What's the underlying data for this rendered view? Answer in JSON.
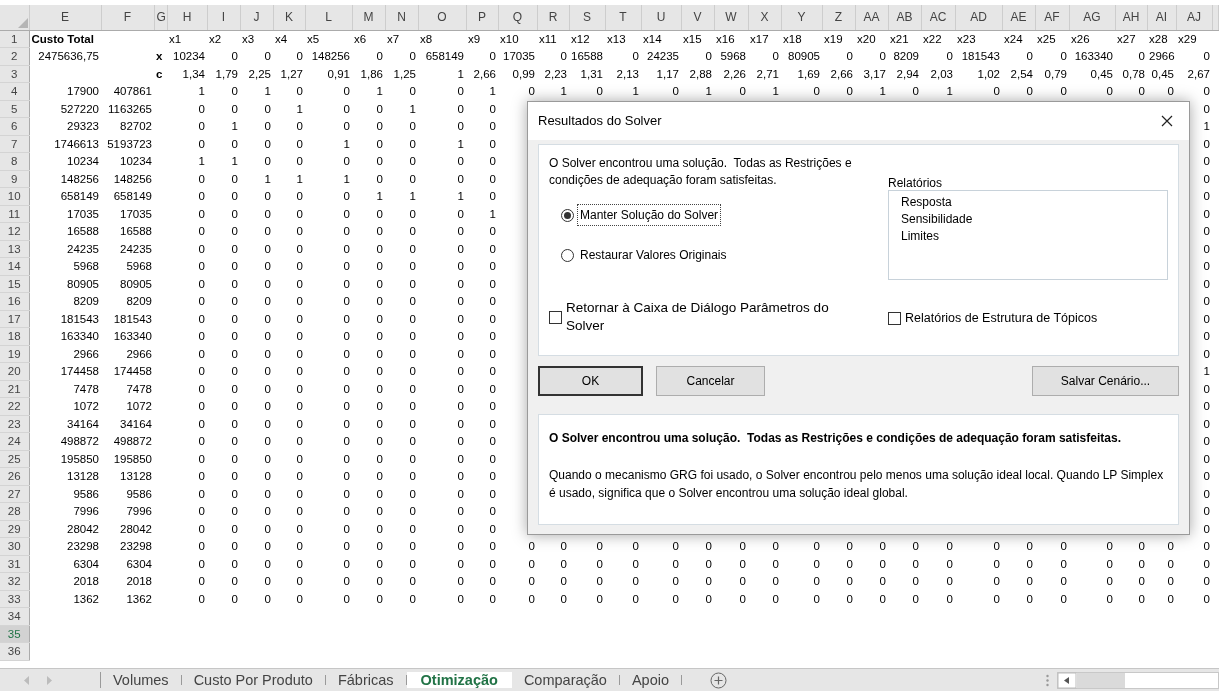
{
  "sheet": {
    "column_headers": [
      "E",
      "F",
      "G",
      "H",
      "I",
      "J",
      "K",
      "L",
      "M",
      "N",
      "O",
      "P",
      "Q",
      "R",
      "S",
      "T",
      "U",
      "V",
      "W",
      "X",
      "Y",
      "Z",
      "AA",
      "AB",
      "AC",
      "AD",
      "AE",
      "AF",
      "AG",
      "AH",
      "AI",
      "AJ"
    ],
    "rows": [
      {
        "number": "1",
        "selected": false,
        "cells": [
          "Custo Total",
          null,
          null,
          "x1",
          "x2",
          "x3",
          "x4",
          "x5",
          "x6",
          "x7",
          "x8",
          "x9",
          "x10",
          "x11",
          "x12",
          "x13",
          "x14",
          "x15",
          "x16",
          "x17",
          "x18",
          "x19",
          "x20",
          "x21",
          "x22",
          "x23",
          "x24",
          "x25",
          "x26",
          "x27",
          "x28",
          "x29"
        ]
      },
      {
        "number": "2",
        "selected": false,
        "cells": [
          "2475636,75",
          null,
          "x",
          "10234",
          "0",
          "0",
          "0",
          "148256",
          "0",
          "0",
          "658149",
          "0",
          "17035",
          "0",
          "16588",
          "0",
          "24235",
          "0",
          "5968",
          "0",
          "80905",
          "0",
          "0",
          "8209",
          "0",
          "181543",
          "0",
          "0",
          "163340",
          "0",
          "2966",
          "0"
        ]
      },
      {
        "number": "3",
        "selected": false,
        "cells": [
          null,
          null,
          "c",
          "1,34",
          "1,79",
          "2,25",
          "1,27",
          "0,91",
          "1,86",
          "1,25",
          "1",
          "2,66",
          "0,99",
          "2,23",
          "1,31",
          "2,13",
          "1,17",
          "2,88",
          "2,26",
          "2,71",
          "1,69",
          "2,66",
          "3,17",
          "2,94",
          "2,03",
          "1,02",
          "2,54",
          "0,79",
          "0,45",
          "0,78",
          "0,45",
          "2,67"
        ]
      },
      {
        "number": "4",
        "selected": false,
        "cells": [
          "17900",
          "407861",
          null,
          "1",
          "0",
          "1",
          "0",
          "0",
          "1",
          "0",
          "0",
          "1",
          "0",
          "1",
          "0",
          "1",
          "0",
          "1",
          "0",
          "1",
          "0",
          "0",
          "1",
          "0",
          "1",
          "0",
          "0",
          "0",
          "0",
          "0",
          "0",
          "0"
        ]
      },
      {
        "number": "5",
        "selected": false,
        "cells": [
          "527220",
          "1163265",
          null,
          "0",
          "0",
          "0",
          "1",
          "0",
          "0",
          "1",
          "0",
          "0",
          null,
          null,
          null,
          null,
          null,
          null,
          null,
          null,
          null,
          null,
          null,
          null,
          null,
          null,
          null,
          null,
          null,
          null,
          null,
          "0"
        ]
      },
      {
        "number": "6",
        "selected": false,
        "cells": [
          "29323",
          "82702",
          null,
          "0",
          "1",
          "0",
          "0",
          "0",
          "0",
          "0",
          "0",
          "0",
          null,
          null,
          null,
          null,
          null,
          null,
          null,
          null,
          null,
          null,
          null,
          null,
          null,
          null,
          null,
          null,
          null,
          null,
          null,
          "1"
        ]
      },
      {
        "number": "7",
        "selected": false,
        "cells": [
          "1746613",
          "5193723",
          null,
          "0",
          "0",
          "0",
          "0",
          "1",
          "0",
          "0",
          "1",
          "0",
          null,
          null,
          null,
          null,
          null,
          null,
          null,
          null,
          null,
          null,
          null,
          null,
          null,
          null,
          null,
          null,
          null,
          null,
          null,
          "0"
        ]
      },
      {
        "number": "8",
        "selected": false,
        "cells": [
          "10234",
          "10234",
          null,
          "1",
          "1",
          "0",
          "0",
          "0",
          "0",
          "0",
          "0",
          "0",
          null,
          null,
          null,
          null,
          null,
          null,
          null,
          null,
          null,
          null,
          null,
          null,
          null,
          null,
          null,
          null,
          null,
          null,
          null,
          "0"
        ]
      },
      {
        "number": "9",
        "selected": false,
        "cells": [
          "148256",
          "148256",
          null,
          "0",
          "0",
          "1",
          "1",
          "1",
          "0",
          "0",
          "0",
          "0",
          null,
          null,
          null,
          null,
          null,
          null,
          null,
          null,
          null,
          null,
          null,
          null,
          null,
          null,
          null,
          null,
          null,
          null,
          null,
          "0"
        ]
      },
      {
        "number": "10",
        "selected": false,
        "cells": [
          "658149",
          "658149",
          null,
          "0",
          "0",
          "0",
          "0",
          "0",
          "1",
          "1",
          "1",
          "0",
          null,
          null,
          null,
          null,
          null,
          null,
          null,
          null,
          null,
          null,
          null,
          null,
          null,
          null,
          null,
          null,
          null,
          null,
          null,
          "0"
        ]
      },
      {
        "number": "11",
        "selected": false,
        "cells": [
          "17035",
          "17035",
          null,
          "0",
          "0",
          "0",
          "0",
          "0",
          "0",
          "0",
          "0",
          "1",
          null,
          null,
          null,
          null,
          null,
          null,
          null,
          null,
          null,
          null,
          null,
          null,
          null,
          null,
          null,
          null,
          null,
          null,
          null,
          "0"
        ]
      },
      {
        "number": "12",
        "selected": false,
        "cells": [
          "16588",
          "16588",
          null,
          "0",
          "0",
          "0",
          "0",
          "0",
          "0",
          "0",
          "0",
          "0",
          null,
          null,
          null,
          null,
          null,
          null,
          null,
          null,
          null,
          null,
          null,
          null,
          null,
          null,
          null,
          null,
          null,
          null,
          null,
          "0"
        ]
      },
      {
        "number": "13",
        "selected": false,
        "cells": [
          "24235",
          "24235",
          null,
          "0",
          "0",
          "0",
          "0",
          "0",
          "0",
          "0",
          "0",
          "0",
          null,
          null,
          null,
          null,
          null,
          null,
          null,
          null,
          null,
          null,
          null,
          null,
          null,
          null,
          null,
          null,
          null,
          null,
          null,
          "0"
        ]
      },
      {
        "number": "14",
        "selected": false,
        "cells": [
          "5968",
          "5968",
          null,
          "0",
          "0",
          "0",
          "0",
          "0",
          "0",
          "0",
          "0",
          "0",
          null,
          null,
          null,
          null,
          null,
          null,
          null,
          null,
          null,
          null,
          null,
          null,
          null,
          null,
          null,
          null,
          null,
          null,
          null,
          "0"
        ]
      },
      {
        "number": "15",
        "selected": false,
        "cells": [
          "80905",
          "80905",
          null,
          "0",
          "0",
          "0",
          "0",
          "0",
          "0",
          "0",
          "0",
          "0",
          null,
          null,
          null,
          null,
          null,
          null,
          null,
          null,
          null,
          null,
          null,
          null,
          null,
          null,
          null,
          null,
          null,
          null,
          null,
          "0"
        ]
      },
      {
        "number": "16",
        "selected": false,
        "cells": [
          "8209",
          "8209",
          null,
          "0",
          "0",
          "0",
          "0",
          "0",
          "0",
          "0",
          "0",
          "0",
          null,
          null,
          null,
          null,
          null,
          null,
          null,
          null,
          null,
          null,
          null,
          null,
          null,
          null,
          null,
          null,
          null,
          null,
          null,
          "0"
        ]
      },
      {
        "number": "17",
        "selected": false,
        "cells": [
          "181543",
          "181543",
          null,
          "0",
          "0",
          "0",
          "0",
          "0",
          "0",
          "0",
          "0",
          "0",
          null,
          null,
          null,
          null,
          null,
          null,
          null,
          null,
          null,
          null,
          null,
          null,
          null,
          null,
          null,
          null,
          null,
          null,
          null,
          "0"
        ]
      },
      {
        "number": "18",
        "selected": false,
        "cells": [
          "163340",
          "163340",
          null,
          "0",
          "0",
          "0",
          "0",
          "0",
          "0",
          "0",
          "0",
          "0",
          null,
          null,
          null,
          null,
          null,
          null,
          null,
          null,
          null,
          null,
          null,
          null,
          null,
          null,
          null,
          null,
          null,
          null,
          null,
          "0"
        ]
      },
      {
        "number": "19",
        "selected": false,
        "cells": [
          "2966",
          "2966",
          null,
          "0",
          "0",
          "0",
          "0",
          "0",
          "0",
          "0",
          "0",
          "0",
          null,
          null,
          null,
          null,
          null,
          null,
          null,
          null,
          null,
          null,
          null,
          null,
          null,
          null,
          null,
          null,
          null,
          null,
          null,
          "0"
        ]
      },
      {
        "number": "20",
        "selected": false,
        "cells": [
          "174458",
          "174458",
          null,
          "0",
          "0",
          "0",
          "0",
          "0",
          "0",
          "0",
          "0",
          "0",
          null,
          null,
          null,
          null,
          null,
          null,
          null,
          null,
          null,
          null,
          null,
          null,
          null,
          null,
          null,
          null,
          null,
          null,
          null,
          "1"
        ]
      },
      {
        "number": "21",
        "selected": false,
        "cells": [
          "7478",
          "7478",
          null,
          "0",
          "0",
          "0",
          "0",
          "0",
          "0",
          "0",
          "0",
          "0",
          null,
          null,
          null,
          null,
          null,
          null,
          null,
          null,
          null,
          null,
          null,
          null,
          null,
          null,
          null,
          null,
          null,
          null,
          null,
          "0"
        ]
      },
      {
        "number": "22",
        "selected": false,
        "cells": [
          "1072",
          "1072",
          null,
          "0",
          "0",
          "0",
          "0",
          "0",
          "0",
          "0",
          "0",
          "0",
          null,
          null,
          null,
          null,
          null,
          null,
          null,
          null,
          null,
          null,
          null,
          null,
          null,
          null,
          null,
          null,
          null,
          null,
          null,
          "0"
        ]
      },
      {
        "number": "23",
        "selected": false,
        "cells": [
          "34164",
          "34164",
          null,
          "0",
          "0",
          "0",
          "0",
          "0",
          "0",
          "0",
          "0",
          "0",
          null,
          null,
          null,
          null,
          null,
          null,
          null,
          null,
          null,
          null,
          null,
          null,
          null,
          null,
          null,
          null,
          null,
          null,
          null,
          "0"
        ]
      },
      {
        "number": "24",
        "selected": false,
        "cells": [
          "498872",
          "498872",
          null,
          "0",
          "0",
          "0",
          "0",
          "0",
          "0",
          "0",
          "0",
          "0",
          null,
          null,
          null,
          null,
          null,
          null,
          null,
          null,
          null,
          null,
          null,
          null,
          null,
          null,
          null,
          null,
          null,
          null,
          null,
          "0"
        ]
      },
      {
        "number": "25",
        "selected": false,
        "cells": [
          "195850",
          "195850",
          null,
          "0",
          "0",
          "0",
          "0",
          "0",
          "0",
          "0",
          "0",
          "0",
          null,
          null,
          null,
          null,
          null,
          null,
          null,
          null,
          null,
          null,
          null,
          null,
          null,
          null,
          null,
          null,
          null,
          null,
          null,
          "0"
        ]
      },
      {
        "number": "26",
        "selected": false,
        "cells": [
          "13128",
          "13128",
          null,
          "0",
          "0",
          "0",
          "0",
          "0",
          "0",
          "0",
          "0",
          "0",
          null,
          null,
          null,
          null,
          null,
          null,
          null,
          null,
          null,
          null,
          null,
          null,
          null,
          null,
          null,
          null,
          null,
          null,
          null,
          "0"
        ]
      },
      {
        "number": "27",
        "selected": false,
        "cells": [
          "9586",
          "9586",
          null,
          "0",
          "0",
          "0",
          "0",
          "0",
          "0",
          "0",
          "0",
          "0",
          null,
          null,
          null,
          null,
          null,
          null,
          null,
          null,
          null,
          null,
          null,
          null,
          null,
          null,
          null,
          null,
          null,
          null,
          null,
          "0"
        ]
      },
      {
        "number": "28",
        "selected": false,
        "cells": [
          "7996",
          "7996",
          null,
          "0",
          "0",
          "0",
          "0",
          "0",
          "0",
          "0",
          "0",
          "0",
          null,
          null,
          null,
          null,
          null,
          null,
          null,
          null,
          null,
          null,
          null,
          null,
          null,
          null,
          null,
          null,
          null,
          null,
          null,
          "0"
        ]
      },
      {
        "number": "29",
        "selected": false,
        "cells": [
          "28042",
          "28042",
          null,
          "0",
          "0",
          "0",
          "0",
          "0",
          "0",
          "0",
          "0",
          "0",
          null,
          null,
          null,
          null,
          null,
          null,
          null,
          null,
          null,
          null,
          null,
          null,
          null,
          null,
          null,
          null,
          null,
          null,
          null,
          "0"
        ]
      },
      {
        "number": "30",
        "selected": false,
        "cells": [
          "23298",
          "23298",
          null,
          "0",
          "0",
          "0",
          "0",
          "0",
          "0",
          "0",
          "0",
          "0",
          "0",
          "0",
          "0",
          "0",
          "0",
          "0",
          "0",
          "0",
          "0",
          "0",
          "0",
          "0",
          "0",
          "0",
          "0",
          "0",
          "0",
          "0",
          "0",
          "0"
        ]
      },
      {
        "number": "31",
        "selected": false,
        "cells": [
          "6304",
          "6304",
          null,
          "0",
          "0",
          "0",
          "0",
          "0",
          "0",
          "0",
          "0",
          "0",
          "0",
          "0",
          "0",
          "0",
          "0",
          "0",
          "0",
          "0",
          "0",
          "0",
          "0",
          "0",
          "0",
          "0",
          "0",
          "0",
          "0",
          "0",
          "0",
          "0"
        ]
      },
      {
        "number": "32",
        "selected": false,
        "cells": [
          "2018",
          "2018",
          null,
          "0",
          "0",
          "0",
          "0",
          "0",
          "0",
          "0",
          "0",
          "0",
          "0",
          "0",
          "0",
          "0",
          "0",
          "0",
          "0",
          "0",
          "0",
          "0",
          "0",
          "0",
          "0",
          "0",
          "0",
          "0",
          "0",
          "0",
          "0",
          "0"
        ]
      },
      {
        "number": "33",
        "selected": false,
        "cells": [
          "1362",
          "1362",
          null,
          "0",
          "0",
          "0",
          "0",
          "0",
          "0",
          "0",
          "0",
          "0",
          "0",
          "0",
          "0",
          "0",
          "0",
          "0",
          "0",
          "0",
          "0",
          "0",
          "0",
          "0",
          "0",
          "0",
          "0",
          "0",
          "0",
          "0",
          "0",
          "0"
        ]
      },
      {
        "number": "34",
        "selected": false
      },
      {
        "number": "35",
        "selected": true
      },
      {
        "number": "36",
        "selected": false
      }
    ]
  },
  "dialog": {
    "title": "Resultados do Solver",
    "message": "O Solver encontrou uma solução.  Todas as Restrições e condições de adequação foram satisfeitas.",
    "options": [
      {
        "label": "Manter Solução do Solver",
        "selected": true
      },
      {
        "label": "Restaurar Valores Originais",
        "selected": false
      }
    ],
    "reports_label": "Relatórios",
    "reports": [
      {
        "label": "Resposta",
        "selected": false
      },
      {
        "label": "Sensibilidade",
        "selected": false
      },
      {
        "label": "Limites",
        "selected": false
      }
    ],
    "return_checkbox": {
      "label": "Retornar à Caixa de Diálogo Parâmetros do Solver",
      "checked": false
    },
    "outline_checkbox": {
      "label": "Relatórios de Estrutura de Tópicos",
      "checked": false
    },
    "buttons": [
      {
        "label": "OK",
        "default": true
      },
      {
        "label": "Cancelar",
        "default": false
      },
      {
        "label": "Salvar Cenário...",
        "default": false
      }
    ],
    "status_title": "O Solver encontrou uma solução.  Todas as Restrições e condições de adequação foram satisfeitas.",
    "status_text": "Quando o mecanismo GRG foi usado, o Solver encontrou pelo menos uma solução ideal local. Quando LP Simplex é usado, significa que o Solver encontrou uma solução ideal global."
  },
  "sheet_tabs": [
    {
      "label": "Volumes",
      "selected": false
    },
    {
      "label": "Custo Por Produto",
      "selected": false
    },
    {
      "label": "Fábricas",
      "selected": false
    },
    {
      "label": "Otimização",
      "selected": true
    },
    {
      "label": "Comparação",
      "selected": false
    },
    {
      "label": "Apoio",
      "selected": false
    }
  ]
}
